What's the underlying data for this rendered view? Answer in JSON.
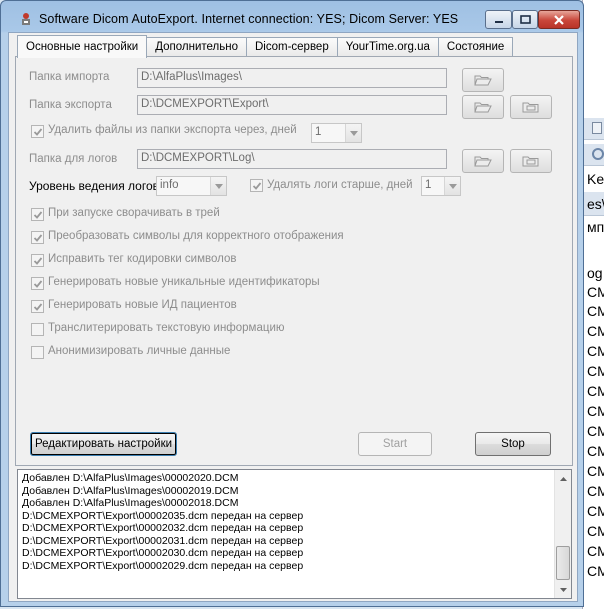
{
  "window": {
    "title": "Software Dicom AutoExport. Internet connection: YES; Dicom Server: YES"
  },
  "tabs": [
    {
      "label": "Основные настройки",
      "active": true
    },
    {
      "label": "Дополнительно",
      "active": false
    },
    {
      "label": "Dicom-сервер",
      "active": false
    },
    {
      "label": "YourTime.org.ua",
      "active": false
    },
    {
      "label": "Состояние",
      "active": false
    }
  ],
  "settings": {
    "import_label": "Папка импорта",
    "import_value": "D:\\AlfaPlus\\Images\\",
    "export_label": "Папка экспорта",
    "export_value": "D:\\DCMEXPORT\\Export\\",
    "delete_files_label": "Удалить файлы из папки экспорта  через, дней",
    "delete_files_days": "1",
    "logs_label": "Папка для логов",
    "logs_value": "D:\\DCMEXPORT\\Log\\",
    "log_level_label": "Уровень ведения логов",
    "log_level_value": "info",
    "delete_logs_label": "Удалять логи старше, дней",
    "delete_logs_days": "1"
  },
  "checkboxes": [
    {
      "label": "При запуске сворачивать в трей",
      "checked": true
    },
    {
      "label": "Преобразовать символы для корректного отображения",
      "checked": true
    },
    {
      "label": "Исправить тег кодировки символов",
      "checked": true
    },
    {
      "label": "Генерировать новые уникальные идентификаторы",
      "checked": true
    },
    {
      "label": "Генерировать новые ИД пациентов",
      "checked": true
    },
    {
      "label": "Транслитерировать текстовую информацию",
      "checked": false
    },
    {
      "label": "Анонимизировать личные данные",
      "checked": false
    }
  ],
  "buttons": {
    "edit": "Редактировать настройки",
    "start": "Start",
    "stop": "Stop"
  },
  "log": [
    "Добавлен D:\\AlfaPlus\\Images\\00002020.DCM",
    "Добавлен D:\\AlfaPlus\\Images\\00002019.DCM",
    "Добавлен D:\\AlfaPlus\\Images\\00002018.DCM",
    "D:\\DCMEXPORT\\Export\\00002035.dcm передан на сервер",
    "D:\\DCMEXPORT\\Export\\00002032.dcm передан на сервер",
    "D:\\DCMEXPORT\\Export\\00002031.dcm передан на сервер",
    "D:\\DCMEXPORT\\Export\\00002030.dcm передан на сервер",
    "D:\\DCMEXPORT\\Export\\00002029.dcm передан на сервер"
  ],
  "background_app": {
    "rows": [
      "Ke",
      "es\\",
      "мп",
      "og",
      "CM",
      "CM",
      "CM",
      "CM",
      "CM",
      "CM",
      "CM",
      "CM",
      "CM",
      "CM",
      "CM",
      "CM",
      "CM",
      "CM",
      "CM"
    ]
  },
  "colors": {
    "title_gradient": "#a9c8e8",
    "close_button": "#c9463a",
    "disabled_text": "#8d8d8d"
  }
}
